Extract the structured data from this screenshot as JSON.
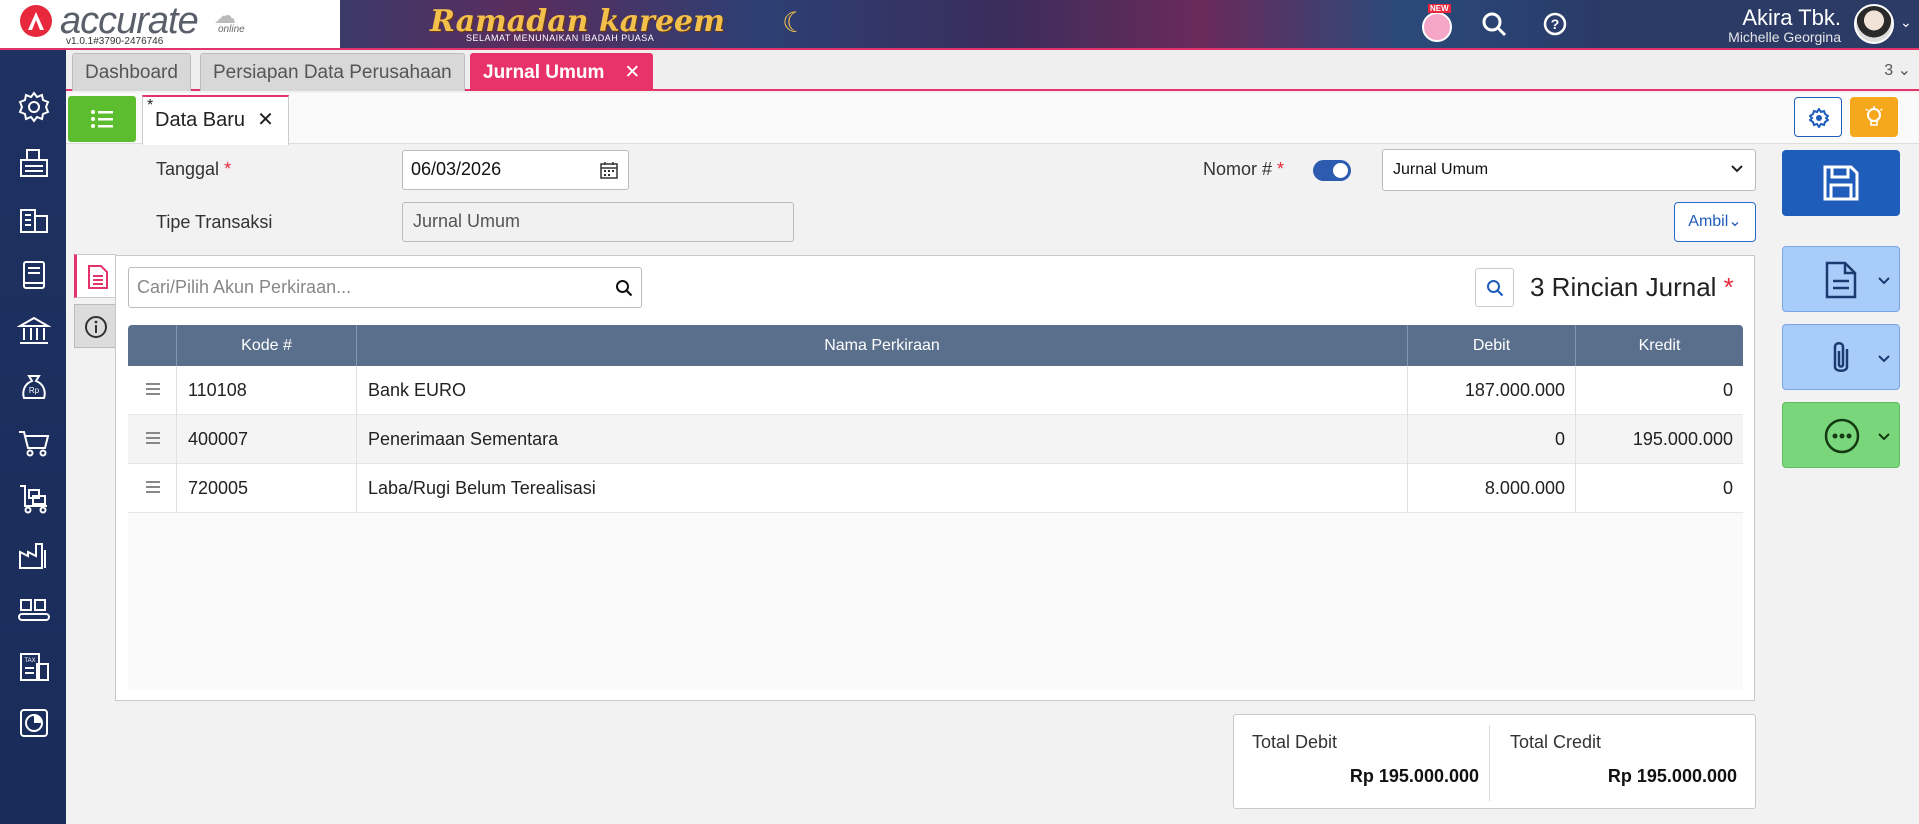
{
  "header": {
    "logo_text": "accurate",
    "logo_online": "online",
    "version": "v1.0.1#3790-2476746",
    "banner_title": "Ramadan kareem",
    "banner_subtitle": "SELAMAT MENUNAIKAN IBADAH PUASA",
    "new_badge": "NEW",
    "company_name": "Akira Tbk.",
    "user_name": "Michelle Georgina"
  },
  "module_tabs": [
    {
      "label": "Dashboard",
      "active": false
    },
    {
      "label": "Persiapan Data Perusahaan",
      "active": false
    },
    {
      "label": "Jurnal Umum",
      "active": true
    }
  ],
  "tab_count": "3",
  "doc_tab": {
    "star": "*",
    "label": "Data Baru"
  },
  "form": {
    "tanggal_label": "Tanggal",
    "tanggal_value": "06/03/2026",
    "tipe_label": "Tipe Transaksi",
    "tipe_value": "Jurnal Umum",
    "nomor_label": "Nomor #",
    "nomor_toggle_on": true,
    "nomor_value": "Jurnal Umum",
    "ambil_label": "Ambil",
    "required_mark": "*"
  },
  "detail": {
    "search_placeholder": "Cari/Pilih Akun Perkiraan...",
    "title": "3 Rincian Jurnal",
    "required_mark": "*",
    "columns": [
      "Kode #",
      "Nama Perkiraan",
      "Debit",
      "Kredit"
    ],
    "rows": [
      {
        "kode": "110108",
        "nama": "Bank EURO",
        "debit": "187.000.000",
        "kredit": "0"
      },
      {
        "kode": "400007",
        "nama": "Penerimaan Sementara",
        "debit": "0",
        "kredit": "195.000.000"
      },
      {
        "kode": "720005",
        "nama": "Laba/Rugi Belum Terealisasi",
        "debit": "8.000.000",
        "kredit": "0"
      }
    ]
  },
  "totals": {
    "debit_label": "Total Debit",
    "debit_value": "Rp 195.000.000",
    "credit_label": "Total Credit",
    "credit_value": "Rp 195.000.000"
  },
  "sidebar_icons": [
    "gear-icon",
    "fax-icon",
    "building-icon",
    "book-icon",
    "bank-icon",
    "money-bag-icon",
    "cart-icon",
    "delivery-cart-icon",
    "factory-icon",
    "conveyor-icon",
    "tax-icon",
    "pie-chart-icon"
  ],
  "colors": {
    "accent": "#e2336b",
    "primary": "#1f5dbb",
    "sidebar": "#1e3160",
    "grid_header": "#5a6f8c",
    "list_button": "#5cbe2e",
    "bulb_button": "#f6a81c"
  }
}
